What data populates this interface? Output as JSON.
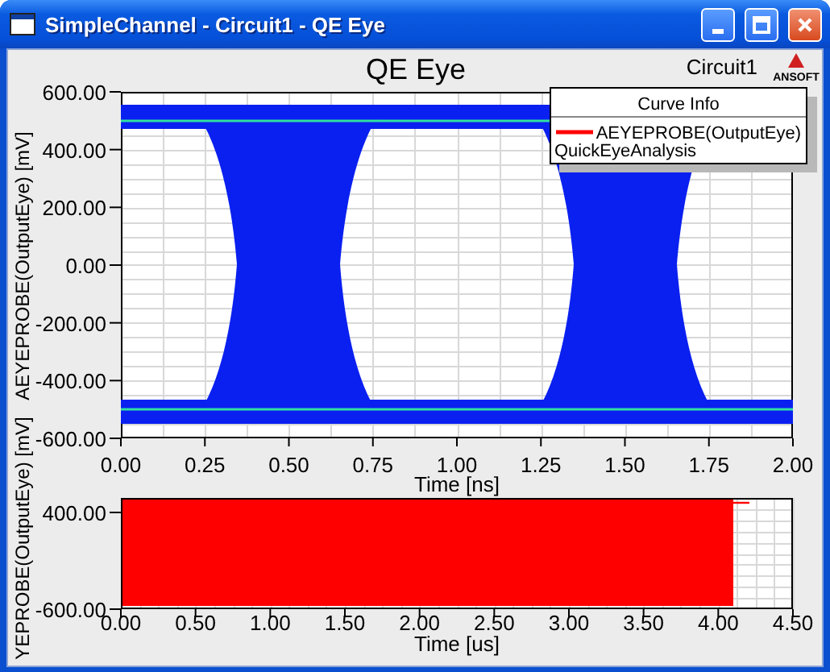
{
  "window": {
    "title": "SimpleChannel - Circuit1 - QE Eye"
  },
  "header": {
    "title": "QE Eye",
    "design": "Circuit1",
    "logo": "ANSOFT"
  },
  "legend": {
    "title": "Curve Info",
    "entries": [
      {
        "name": "AEYEPROBE(OutputEye)"
      }
    ],
    "note": "QuickEyeAnalysis"
  },
  "eye_plot": {
    "ylabel": "AEYEPROBE(OutputEye) [mV]",
    "xlabel": "Time [ns]",
    "yticks": [
      "600.00",
      "400.00",
      "200.00",
      "0.00",
      "-200.00",
      "-400.00",
      "-600.00"
    ],
    "xticks": [
      "0.00",
      "0.25",
      "0.50",
      "0.75",
      "1.00",
      "1.25",
      "1.50",
      "1.75",
      "2.00"
    ]
  },
  "waveform_plot": {
    "ylabel": "YEPROBE(OutputEye) [mV]",
    "xlabel": "Time [us]",
    "yticks": [
      "400.00",
      "-600.00"
    ],
    "xticks": [
      "0.00",
      "0.50",
      "1.00",
      "1.50",
      "2.00",
      "2.50",
      "3.00",
      "3.50",
      "4.00",
      "4.50"
    ]
  }
}
